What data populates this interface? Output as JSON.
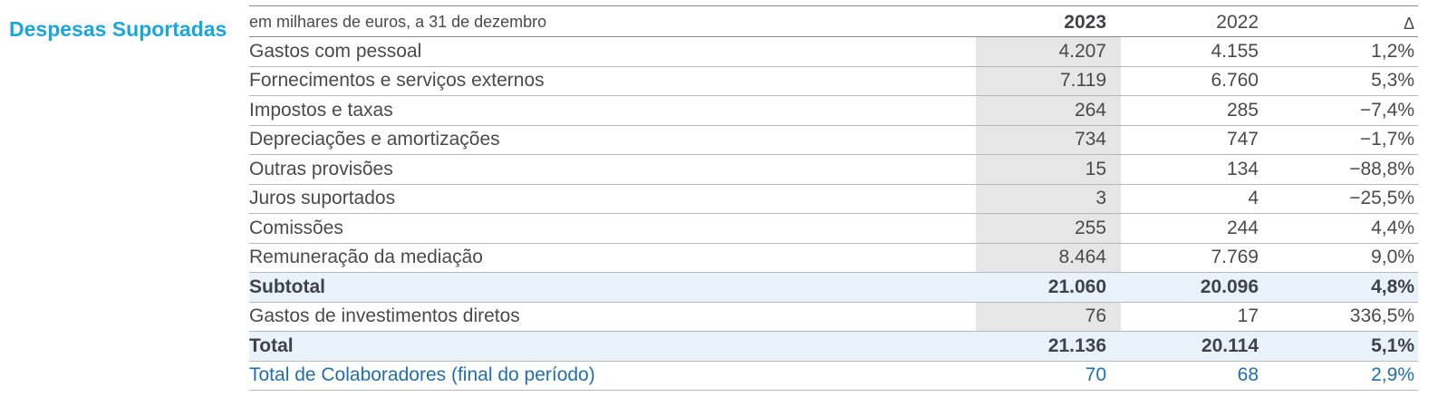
{
  "section": {
    "title": "Despesas Suportadas"
  },
  "header": {
    "unit_note": "em milhares de euros, a 31 de dezembro",
    "col_2023": "2023",
    "col_2022": "2022",
    "col_delta": "Δ"
  },
  "rows": [
    {
      "label": "Gastos com pessoal",
      "v2023": "4.207",
      "v2022": "4.155",
      "delta": "1,2%"
    },
    {
      "label": "Fornecimentos e serviços externos",
      "v2023": "7.119",
      "v2022": "6.760",
      "delta": "5,3%"
    },
    {
      "label": "Impostos e taxas",
      "v2023": "264",
      "v2022": "285",
      "delta": "−7,4%"
    },
    {
      "label": "Depreciações e amortizações",
      "v2023": "734",
      "v2022": "747",
      "delta": "−1,7%"
    },
    {
      "label": "Outras provisões",
      "v2023": "15",
      "v2022": "134",
      "delta": "−88,8%"
    },
    {
      "label": "Juros suportados",
      "v2023": "3",
      "v2022": "4",
      "delta": "−25,5%"
    },
    {
      "label": "Comissões",
      "v2023": "255",
      "v2022": "244",
      "delta": "4,4%"
    },
    {
      "label": "Remuneração da mediação",
      "v2023": "8.464",
      "v2022": "7.769",
      "delta": "9,0%"
    }
  ],
  "subtotal": {
    "label": "Subtotal",
    "v2023": "21.060",
    "v2022": "20.096",
    "delta": "4,8%"
  },
  "direct_investments": {
    "label": "Gastos de investimentos diretos",
    "v2023": "76",
    "v2022": "17",
    "delta": "336,5%"
  },
  "total": {
    "label": "Total",
    "v2023": "21.136",
    "v2022": "20.114",
    "delta": "5,1%"
  },
  "employees": {
    "label": "Total de Colaboradores (final do período)",
    "v2023": "70",
    "v2022": "68",
    "delta": "2,9%"
  },
  "colors": {
    "title": "#1aa7df",
    "highlight_row": "#e9f2fa",
    "shaded_column": "#e6e6e6",
    "employees_text": "#1f6fb0"
  }
}
